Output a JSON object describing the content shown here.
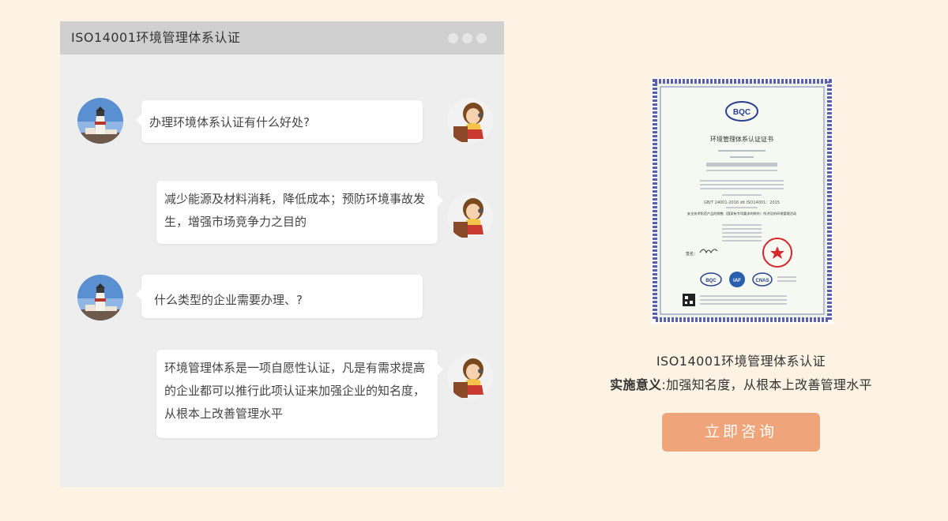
{
  "chat": {
    "title": "ISO14001环境管理体系认证",
    "messages": [
      {
        "role": "user",
        "text": "办理环境体系认证有什么好处?"
      },
      {
        "role": "agent",
        "text": "减少能源及材料消耗，降低成本；预防环境事故发生，增强市场竞争力之目的"
      },
      {
        "role": "user",
        "text": "什么类型的企业需要办理、?"
      },
      {
        "role": "agent",
        "text": " 环境管理体系是一项自愿性认证，凡是有需求提高的企业都可以推行此项认证来加强企业的知名度，从根本上改善管理水平"
      }
    ]
  },
  "certificate": {
    "logo_text": "BQC",
    "title": "环境管理体系认证证书",
    "standard": "GB/T 24001-2016 idt ISO14001：2015",
    "scope": "安全技术防范产品的销售（国家有专项要求的除外）所涉及的环境管理活动",
    "sign_label": "签名：",
    "badges": [
      "BQC",
      "IAF",
      "CNAS"
    ]
  },
  "right_panel": {
    "caption": "ISO14001环境管理体系认证",
    "significance_label": "实施意义",
    "significance_text": ":加强知名度，从根本上改善管理水平",
    "button_label": "立即咨询"
  },
  "colors": {
    "page_bg": "#fdf3e4",
    "chat_bg": "#eeeeee",
    "titlebar_bg": "#d0d0d0",
    "button_bg": "#f0a47a",
    "cert_border": "#5b5fae"
  }
}
